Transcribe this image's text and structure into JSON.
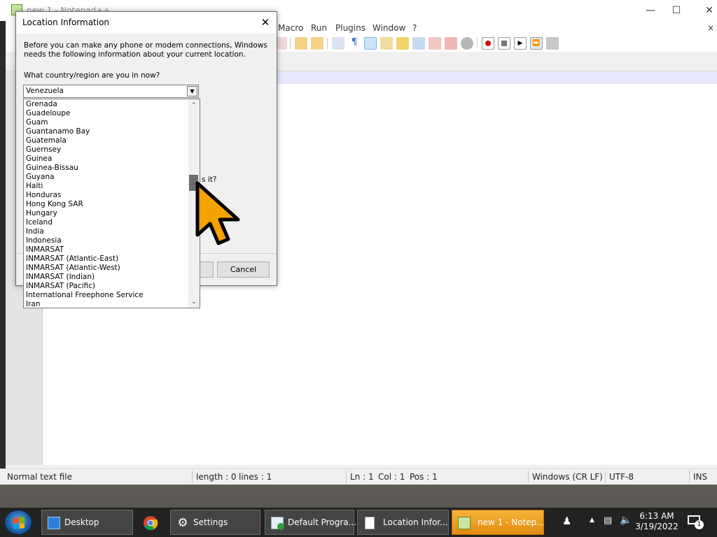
{
  "notepad": {
    "title": "new 1 - Notepad++",
    "menu": [
      "Macro",
      "Run",
      "Plugins",
      "Window",
      "?"
    ],
    "status": {
      "file_type": "Normal text file",
      "length": "length : 0",
      "lines": "lines : 1",
      "ln": "Ln : 1",
      "col": "Col : 1",
      "pos": "Pos : 1",
      "eol": "Windows (CR LF)",
      "encoding": "UTF-8",
      "mode": "INS"
    }
  },
  "dialog": {
    "title": "Location Information",
    "intro": "Before you can make any phone or modem connections, Windows needs the following information about your current location.",
    "country_question": "What country/region are you in now?",
    "selected_country": "Venezuela",
    "partial_question": "s it?",
    "cancel_label": "Cancel",
    "countries": [
      "Grenada",
      "Guadeloupe",
      "Guam",
      "Guantanamo Bay",
      "Guatemala",
      "Guernsey",
      "Guinea",
      "Guinea-Bissau",
      "Guyana",
      "Haiti",
      "Honduras",
      "Hong Kong SAR",
      "Hungary",
      "Iceland",
      "India",
      "Indonesia",
      "INMARSAT",
      "INMARSAT (Atlantic-East)",
      "INMARSAT (Atlantic-West)",
      "INMARSAT (Indian)",
      "INMARSAT (Pacific)",
      "International Freephone Service",
      "Iran"
    ]
  },
  "taskbar": {
    "items": [
      {
        "label": "Desktop",
        "icon": "desktop-icon"
      },
      {
        "label": "Settings",
        "icon": "gear-icon"
      },
      {
        "label": "Default Progra...",
        "icon": "default-programs-icon"
      },
      {
        "label": "Location Infor...",
        "icon": "document-icon"
      },
      {
        "label": "new 1 - Notep...",
        "icon": "notepadpp-icon"
      }
    ],
    "clock_time": "6:13 AM",
    "clock_date": "3/19/2022",
    "notification_count": "1"
  },
  "colors": {
    "active_task": "#f0a020",
    "cursor_fill": "#f5a200"
  }
}
